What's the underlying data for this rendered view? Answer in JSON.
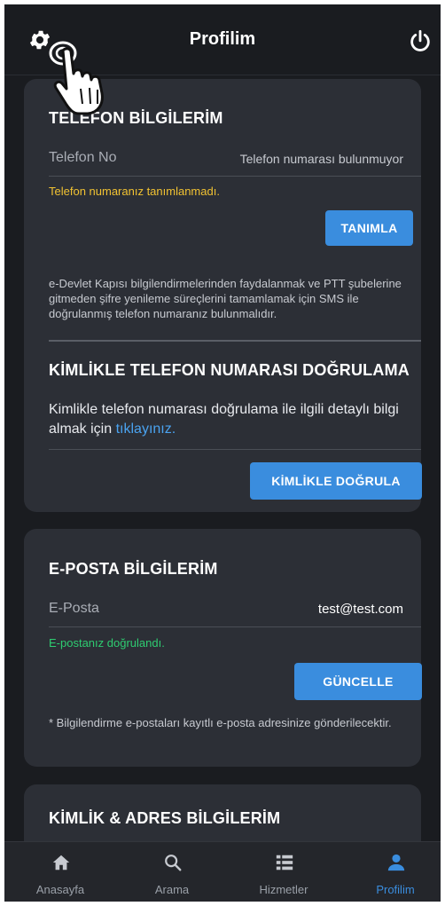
{
  "header": {
    "title": "Profilim",
    "left_icon": "gear-icon",
    "right_icon": "power-icon"
  },
  "phone": {
    "title": "TELEFON BİLGİLERİM",
    "label": "Telefon No",
    "value": "Telefon numarası bulunmuyor",
    "status": "Telefon numaranız tanımlanmadı.",
    "button": "TANIMLA",
    "info": "e-Devlet Kapısı bilgilendirmelerinden faydalanmak ve PTT şubelerine gitmeden şifre yenileme süreçlerini tamamlamak için SMS ile doğrulanmış telefon numaranız bulunmalıdır."
  },
  "verify": {
    "title": "KİMLİKLE TELEFON NUMARASI DOĞRULAMA",
    "text": "Kimlikle telefon numarası doğrulama ile ilgili detaylı bilgi almak için",
    "link": "tıklayınız.",
    "button": "KİMLİKLE DOĞRULA"
  },
  "email": {
    "title": "E-POSTA BİLGİLERİM",
    "label": "E-Posta",
    "value": "test@test.com",
    "status": "E-postanız doğrulandı.",
    "button": "GÜNCELLE",
    "info": "* Bilgilendirme e-postaları kayıtlı e-posta adresinize gönderilecektir."
  },
  "identity": {
    "title": "KİMLİK & ADRES BİLGİLERİM"
  },
  "nav": {
    "items": [
      {
        "label": "Anasayfa",
        "icon": "home-icon",
        "active": false
      },
      {
        "label": "Arama",
        "icon": "search-icon",
        "active": false
      },
      {
        "label": "Hizmetler",
        "icon": "list-icon",
        "active": false
      },
      {
        "label": "Profilim",
        "icon": "user-icon",
        "active": true
      }
    ]
  },
  "colors": {
    "background": "#1a1c20",
    "card": "#2c2f36",
    "accent": "#3a8dde",
    "warning": "#f1c232",
    "success": "#2ecc71"
  }
}
